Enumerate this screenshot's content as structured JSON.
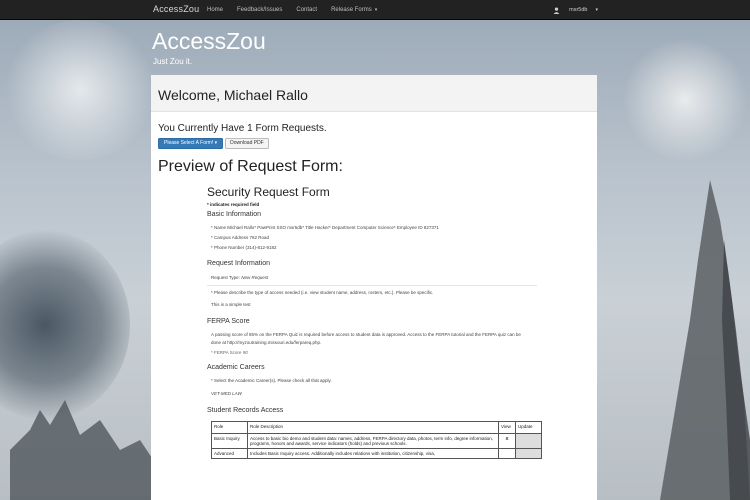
{
  "navbar": {
    "brand": "AccessZou",
    "items": [
      {
        "label": "Home"
      },
      {
        "label": "Feedback/Issues"
      },
      {
        "label": "Contact"
      },
      {
        "label": "Release Forms",
        "caret": "▾"
      }
    ],
    "user": {
      "name": "msr5db",
      "caret": "▾",
      "icon": "user-icon"
    }
  },
  "header": {
    "title": "AccessZou",
    "tagline": "Just Zou it."
  },
  "main": {
    "welcome": "Welcome, Michael Rallo",
    "form_count": "You Currently Have 1 Form Requests.",
    "select_button": "Please Select A Form!",
    "select_caret": "▾",
    "download_button": "Download PDF",
    "preview_title": "Preview of Request Form:"
  },
  "form": {
    "title": "Security Request Form",
    "required_note": "* indicates required field",
    "basic_info": {
      "heading": "Basic Information",
      "line1": "* Name Michael Rallo* PawPrint SSO msr5db* Title Hacker* Department Computer Science* Employee ID 827371",
      "line2": "* Campus Address 762 Road",
      "line3": "* Phone Number (314)-812-9182"
    },
    "request_info": {
      "heading": "Request Information",
      "type_label": "Request Type:",
      "type_value": "New Request",
      "describe_question": "* Please describe the type of access needed (i.e. view student name, address, rosters, etc.). Please be specific.",
      "describe_answer": "This is a simple test"
    },
    "ferpa": {
      "heading": "FERPA Score",
      "text": "A passing score of 85% on the FERPA Quiz is required before access to student data is approved. Access to the FERPA tutorial and the FERPA quiz can be done at http://myzoutraining.missouri.edu/ferpareq.php.",
      "score_label": "* FERPA Score",
      "score_value": "90"
    },
    "academic_careers": {
      "heading": "Academic Careers",
      "question": "* Select the Academic Career(s). Please check all that apply.",
      "answer": "VET-MED LAW"
    },
    "student_records": {
      "heading": "Student Records Access",
      "columns": [
        "Role",
        "Role Description",
        "View",
        "Update"
      ],
      "rows": [
        {
          "role": "Basic Inquiry",
          "description": "Access to basic bio demo and student data: names, address, FERPA directory data, photos, term info, degree information, programs, honors and awards, service indicators (holds) and previous schools.",
          "view": "X",
          "update": ""
        },
        {
          "role": "Advanced",
          "description": "Includes Basic Inquiry access. Additionally includes relations with institution, citizenship, visa,",
          "view": "",
          "update": ""
        }
      ]
    }
  }
}
